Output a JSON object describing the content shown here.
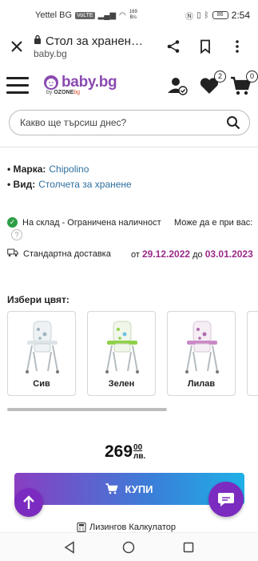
{
  "status_bar": {
    "carrier": "Yettel BG",
    "network_badge": "VoLTE",
    "speed_value": "169",
    "speed_unit": "B/s",
    "battery": "86",
    "time": "2:54",
    "icons": [
      "signal-icon",
      "wifi-icon",
      "nfc-icon",
      "vibrate-icon",
      "bluetooth-icon",
      "battery-icon"
    ]
  },
  "browser": {
    "page_title": "Стол за хранен…",
    "url": "baby.bg",
    "icons": [
      "close-icon",
      "lock-icon",
      "share-icon",
      "bookmark-icon",
      "more-icon"
    ]
  },
  "site_header": {
    "logo_text": "baby.bg",
    "logo_sub_prefix": "by",
    "logo_sub_brand": "OZONE",
    "logo_sub_suffix": "bg",
    "wishlist_count": "2",
    "cart_count": "0",
    "brand_color": "#8a4ab0"
  },
  "search": {
    "placeholder": "Какво ще търсиш днес?"
  },
  "specs": [
    {
      "key": "Марка:",
      "value": "Chipolino"
    },
    {
      "key": "Вид:",
      "value": "Столчета за хранене"
    }
  ],
  "stock": {
    "status": "На склад - Ограничена наличност",
    "may_be": "Може да е при вас:",
    "status_color": "#2e9e46"
  },
  "delivery": {
    "label": "Стандартна доставка",
    "from_word": "от",
    "from_date": "29.12.2022",
    "to_word": "до",
    "to_date": "03.01.2023",
    "date_color": "#9a2a8a"
  },
  "colors": {
    "heading": "Избери цвят:",
    "options": [
      {
        "label": "Сив",
        "accent": "#9fb4c0"
      },
      {
        "label": "Зелен",
        "accent": "#8fd14a"
      },
      {
        "label": "Лилав",
        "accent": "#b06ab0"
      }
    ]
  },
  "price": {
    "integer": "269",
    "fraction": "00",
    "currency": "лв."
  },
  "buy_button": {
    "label": "КУПИ"
  },
  "leasing": {
    "label": "Лизингов Калкулатор"
  }
}
